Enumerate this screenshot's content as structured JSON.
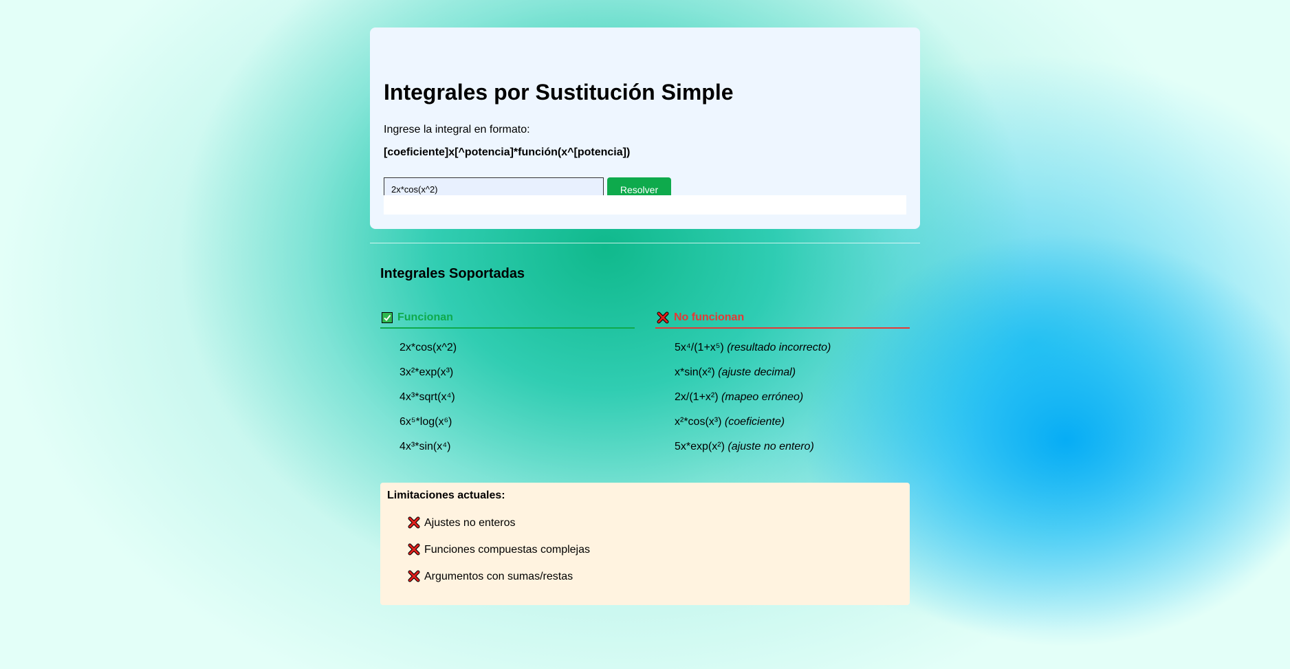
{
  "header": {
    "title": "Integrales por Sustitución Simple",
    "instruction": "Ingrese la integral en formato:",
    "format": "[coeficiente]x[^potencia]*función(x^[potencia])"
  },
  "form": {
    "input_value": "2x*cos(x^2)",
    "button_label": "Resolver"
  },
  "supported": {
    "title": "Integrales Soportadas",
    "working": {
      "label": "Funcionan",
      "items": [
        "2x*cos(x^2)",
        "3x²*exp(x³)",
        "4x³*sqrt(x⁴)",
        "6x⁵*log(x⁶)",
        "4x³*sin(x⁴)"
      ]
    },
    "not_working": {
      "label": "No funcionan",
      "items": [
        {
          "expr": "5x⁴/(1+x⁵)",
          "note": "(resultado incorrecto)"
        },
        {
          "expr": "x*sin(x²)",
          "note": "(ajuste decimal)"
        },
        {
          "expr": "2x/(1+x²)",
          "note": "(mapeo erróneo)"
        },
        {
          "expr": "x²*cos(x³)",
          "note": "(coeficiente)"
        },
        {
          "expr": "5x*exp(x²)",
          "note": "(ajuste no entero)"
        }
      ]
    }
  },
  "limitations": {
    "title": "Limitaciones actuales:",
    "items": [
      "Ajustes no enteros",
      "Funciones compuestas complejas",
      "Argumentos con sumas/restas"
    ]
  },
  "colors": {
    "accent_green": "#0eaa4c",
    "accent_red": "#e53935",
    "card_bg": "#eef6ff",
    "limits_bg": "#fff3e0"
  },
  "icons": {
    "working": "check-box-icon",
    "not_working": "cross-mark-icon"
  }
}
